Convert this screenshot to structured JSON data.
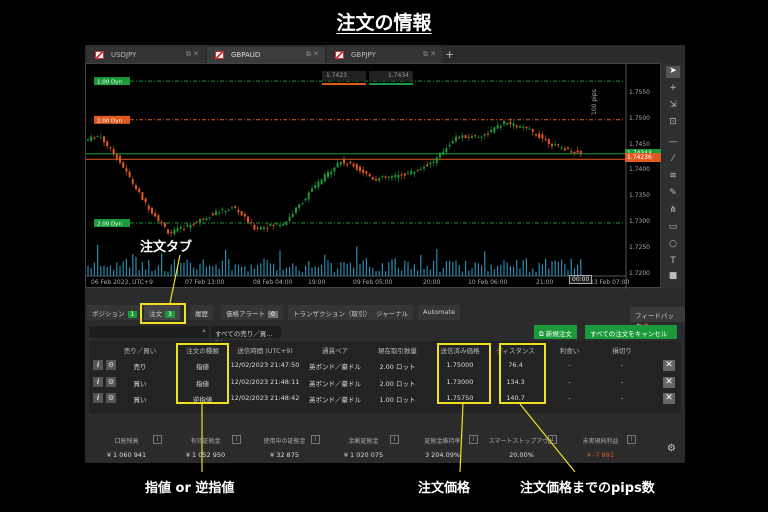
{
  "title": "注文の情報",
  "tabs": [
    {
      "label": "USDJPY"
    },
    {
      "label": "GBPAUD",
      "active": true
    },
    {
      "label": "GBPJPY"
    }
  ],
  "chart": {
    "bid": "1.7423",
    "ask": "1.7434",
    "price_labels": [
      "1.7550",
      "1.7500",
      "1.7450",
      "1.7400",
      "1.7350",
      "1.7300",
      "1.7250",
      "1.7200"
    ],
    "current_ask": "1.74343",
    "current_bid": "1.74236",
    "order_lines": [
      {
        "label": "1.00 Dyn",
        "price": 1.7575,
        "color": "#1a9a3a"
      },
      {
        "label": "2.00 Dyn",
        "price": 1.75,
        "color": "#e05a20"
      },
      {
        "label": "2.00 Dyn",
        "price": 1.73,
        "color": "#1a9a3a"
      }
    ],
    "ruler": "100 pips",
    "time_labels": [
      "06 Feb 2023, UTC+9",
      "07 Feb 13:00",
      "08 Feb 04:00",
      "19:00",
      "09 Feb 05:00",
      "20:00",
      "10 Feb 06:00",
      "21:00",
      "13 Feb 07:00"
    ],
    "cursor_time": "00:00",
    "colors": {
      "up": "#1a9a3a",
      "down": "#e05a20",
      "volume": "#2a8ab0"
    }
  },
  "panel": {
    "tabs": [
      {
        "label": "ポジション",
        "badge": "1"
      },
      {
        "label": "注文",
        "badge": "3"
      },
      {
        "label": "履歴"
      },
      {
        "label": "価格アラート",
        "badge": "0"
      },
      {
        "label": "トランザクション（取引）"
      },
      {
        "label": "ジャーナル"
      },
      {
        "label": "Automate"
      }
    ],
    "feedback": "フィードバック",
    "filter": "すべての売り／買...",
    "new_order": "新規注文",
    "cancel_all": "すべての注文をキャンセルする",
    "columns": [
      "売り／買い",
      "注文の種類",
      "送信時間 (UTC+9)",
      "通貨ペア",
      "現在取引数量",
      "送信済み価格",
      "ディスタンス",
      "利食い",
      "損切り"
    ],
    "rows": [
      [
        "売り",
        "指値",
        "12/02/2023 21:47:50",
        "英ポンド／豪ドル",
        "2.00 ロット",
        "1.75000",
        "76.4",
        "-",
        "-"
      ],
      [
        "買い",
        "指値",
        "12/02/2023 21:48:11",
        "英ポンド／豪ドル",
        "2.00 ロット",
        "1.73000",
        "134.3",
        "-",
        "-"
      ],
      [
        "買い",
        "逆指値",
        "12/02/2023 21:48:42",
        "英ポンド／豪ドル",
        "1.00 ロット",
        "1.75750",
        "140.7",
        "-",
        "-"
      ]
    ]
  },
  "footer": [
    {
      "label": "口座残高",
      "value": "¥ 1 060 941"
    },
    {
      "label": "有効証拠金",
      "value": "¥ 1 052 950"
    },
    {
      "label": "使用中の証拠金",
      "value": "¥ 32 875"
    },
    {
      "label": "余剰証拠金",
      "value": "¥ 1 020 075"
    },
    {
      "label": "証拠金維持率",
      "value": "3 204.09%"
    },
    {
      "label": "スマートストップアウト",
      "value": "20.00%"
    },
    {
      "label": "未実現純利益",
      "value": "¥ -7 991"
    }
  ],
  "annotations": {
    "tab": "注文タブ",
    "type": "指値 or 逆指値",
    "price": "注文価格",
    "distance": "注文価格までのpips数"
  }
}
